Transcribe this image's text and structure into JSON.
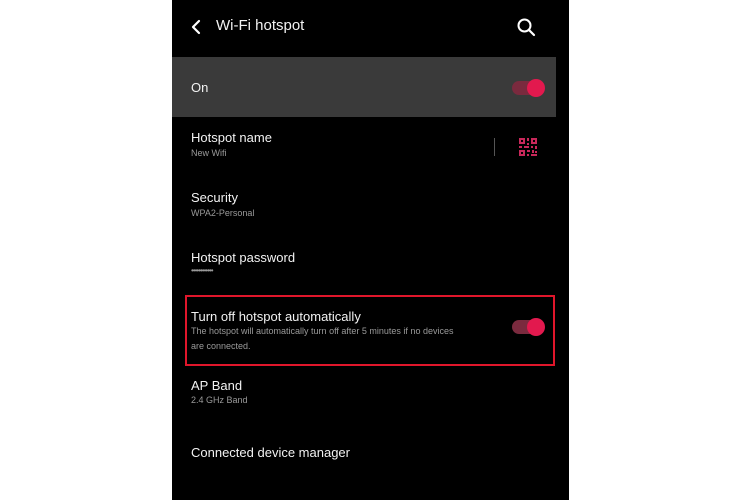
{
  "header": {
    "title": "Wi-Fi hotspot",
    "back_icon": "back-arrow-icon",
    "search_icon": "search-icon"
  },
  "master": {
    "label": "On",
    "enabled": true
  },
  "settings": {
    "hotspot_name": {
      "label": "Hotspot name",
      "value": "New Wifi",
      "qr_icon": "qr-code-icon"
    },
    "security": {
      "label": "Security",
      "value": "WPA2-Personal"
    },
    "password": {
      "label": "Hotspot password",
      "value": "••••••••••••"
    },
    "auto_off": {
      "label": "Turn off hotspot automatically",
      "description_line1": "The hotspot will automatically turn off after 5 minutes if no devices",
      "description_line2": "are connected.",
      "enabled": true
    },
    "ap_band": {
      "label": "AP Band",
      "value": "2.4 GHz Band"
    },
    "device_manager": {
      "label": "Connected device manager"
    }
  },
  "colors": {
    "accent": "#e2194e",
    "toggle_track": "#7a2a3e",
    "background": "#000000",
    "on_row": "#3a3a3a",
    "highlight": "#e0162b"
  }
}
